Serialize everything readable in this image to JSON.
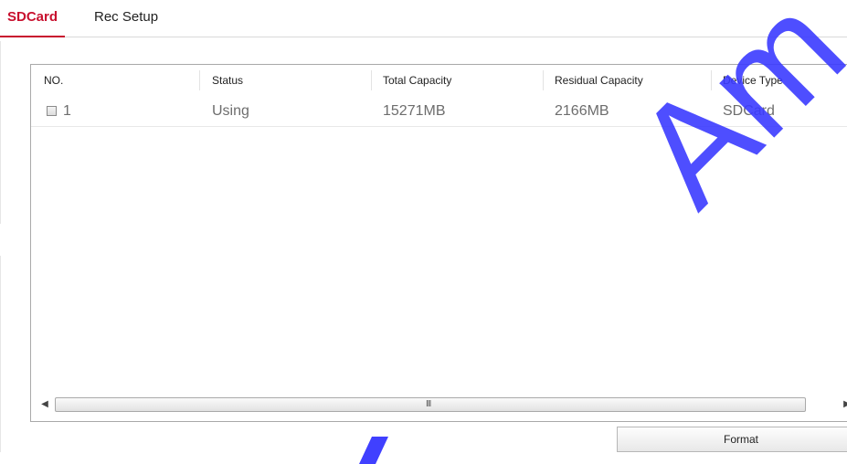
{
  "tabs": [
    {
      "label": "SDCard",
      "active": true
    },
    {
      "label": "Rec Setup",
      "active": false
    }
  ],
  "table": {
    "columns": [
      "NO.",
      "Status",
      "Total Capacity",
      "Residual Capacity",
      "Device Type"
    ],
    "rows": [
      {
        "no": "1",
        "status": "Using",
        "total": "15271MB",
        "residual": "2166MB",
        "type": "SDCard",
        "checked": false
      }
    ]
  },
  "scrollbar": {
    "left_arrow": "◀",
    "right_arrow": "▶",
    "grip": "III"
  },
  "buttons": {
    "format": "Format"
  },
  "watermark": {
    "text": "Am"
  },
  "colors": {
    "accent": "#c8102e",
    "watermark": "#3b3bff"
  }
}
